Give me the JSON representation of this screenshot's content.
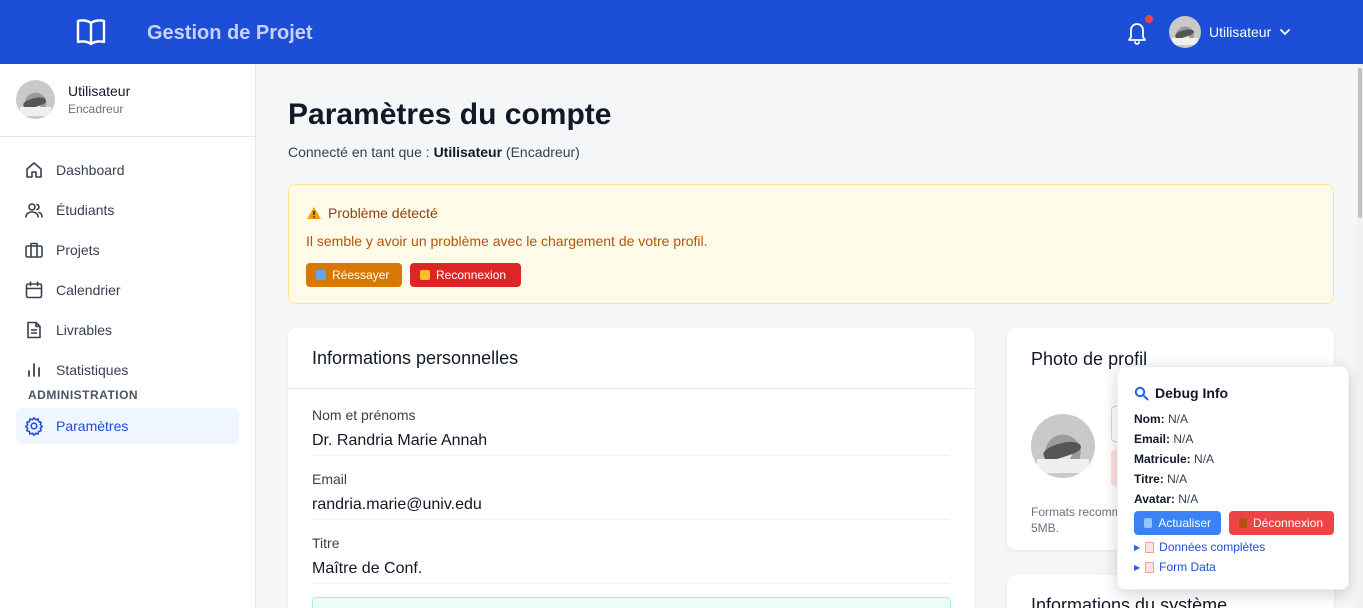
{
  "header": {
    "brand": "Gestion de Projet",
    "user_name": "Utilisateur",
    "icons": [
      "book-icon",
      "bell-icon",
      "chevron-down-icon"
    ],
    "accent_color": "#1d4ed8"
  },
  "sidebar": {
    "profile": {
      "name": "Utilisateur",
      "role": "Encadreur"
    },
    "items": [
      {
        "label": "Dashboard",
        "icon": "home-icon"
      },
      {
        "label": "Étudiants",
        "icon": "users-icon"
      },
      {
        "label": "Projets",
        "icon": "briefcase-icon"
      },
      {
        "label": "Calendrier",
        "icon": "calendar-icon"
      },
      {
        "label": "Livrables",
        "icon": "document-icon"
      },
      {
        "label": "Statistiques",
        "icon": "bar-chart-icon"
      }
    ],
    "section_label": "ADMINISTRATION",
    "admin_items": [
      {
        "label": "Paramètres",
        "icon": "gear-icon",
        "active": true
      }
    ]
  },
  "main": {
    "title": "Paramètres du compte",
    "subtitle_prefix": "Connecté en tant que :",
    "subtitle_user": "Utilisateur",
    "subtitle_role": "(Encadreur)"
  },
  "alert": {
    "title": "Problème détecté",
    "message": "Il semble y avoir un problème avec le chargement de votre profil.",
    "retry_label": "Réessayer",
    "reconnect_label": "Reconnexion"
  },
  "personal_info": {
    "title": "Informations personnelles",
    "fields": [
      {
        "label": "Nom et prénoms",
        "value": "Dr. Randria Marie Annah"
      },
      {
        "label": "Email",
        "value": "randria.marie@univ.edu"
      },
      {
        "label": "Titre",
        "value": "Maître de Conf."
      }
    ]
  },
  "photo": {
    "title": "Photo de profil",
    "note_line1": "Formats recomm",
    "note_line2": "5MB."
  },
  "system": {
    "title": "Informations du système"
  },
  "debug": {
    "title": "Debug Info",
    "rows": [
      {
        "key": "Nom:",
        "value": "N/A"
      },
      {
        "key": "Email:",
        "value": "N/A"
      },
      {
        "key": "Matricule:",
        "value": "N/A"
      },
      {
        "key": "Titre:",
        "value": "N/A"
      },
      {
        "key": "Avatar:",
        "value": "N/A"
      }
    ],
    "refresh_label": "Actualiser",
    "logout_label": "Déconnexion",
    "links": [
      "Données complètes",
      "Form Data"
    ]
  }
}
